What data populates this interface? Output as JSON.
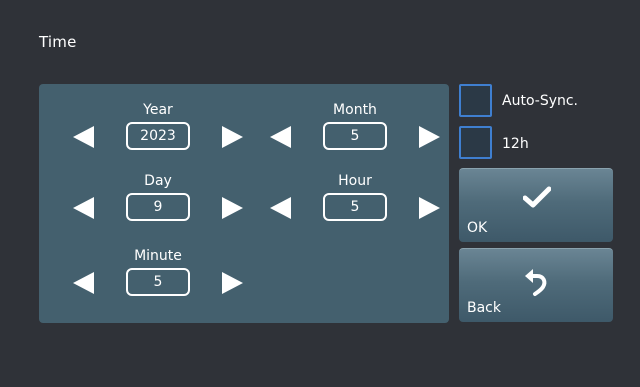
{
  "title": "Time",
  "fields": {
    "year": {
      "label": "Year",
      "value": "2023"
    },
    "month": {
      "label": "Month",
      "value": "5"
    },
    "day": {
      "label": "Day",
      "value": "9"
    },
    "hour": {
      "label": "Hour",
      "value": "5"
    },
    "minute": {
      "label": "Minute",
      "value": "5"
    }
  },
  "options": {
    "auto_sync": {
      "label": "Auto-Sync.",
      "checked": false
    },
    "h12": {
      "label": "12h",
      "checked": false
    }
  },
  "buttons": {
    "ok": {
      "label": "OK",
      "icon": "checkmark-icon"
    },
    "back": {
      "label": "Back",
      "icon": "back-arrow-icon"
    }
  },
  "colors": {
    "background": "#2f3238",
    "panel": "#44606e",
    "checkbox_border": "#3f7fd0"
  }
}
